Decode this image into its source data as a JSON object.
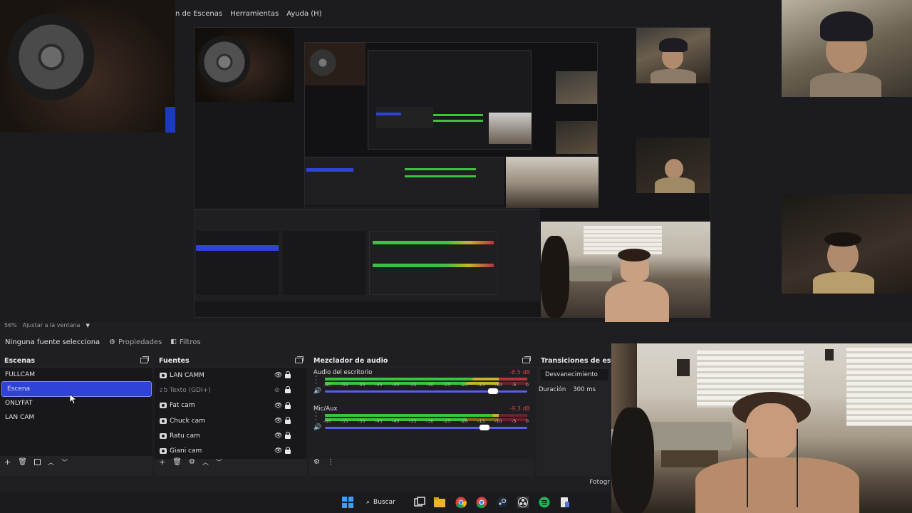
{
  "menu": {
    "items": [
      "n de Escenas",
      "Herramientas",
      "Ayuda (H)"
    ]
  },
  "preview": {
    "zoom": "56%",
    "fit_mode": "Ajustar a la ventana"
  },
  "toolbar": {
    "no_selection": "Ninguna fuente selecciona",
    "properties": "Propiedades",
    "filters": "Filtros"
  },
  "scenes": {
    "title": "Escenas",
    "items": [
      "FULLCAM",
      "Escena",
      "ONLYFAT",
      "LAN CAM"
    ],
    "selected": "Escena"
  },
  "sources": {
    "title": "Fuentes",
    "items": [
      {
        "label": "LAN CAMM",
        "visible": true
      },
      {
        "label": "Texto (GDI+)",
        "visible": false
      },
      {
        "label": "Fat cam",
        "visible": true
      },
      {
        "label": "Chuck cam",
        "visible": true
      },
      {
        "label": "Ratu cam",
        "visible": true
      },
      {
        "label": "Giani cam",
        "visible": true
      }
    ]
  },
  "mixer": {
    "title": "Mezclador de audio",
    "tracks": [
      {
        "name": "Audio del escritorio",
        "db": "-8.5 dB",
        "volume": 0.83
      },
      {
        "name": "Mic/Aux",
        "db": "-9.3 dB",
        "volume": 0.79
      }
    ],
    "scale": [
      "-60",
      "-55",
      "-50",
      "-45",
      "-40",
      "-35",
      "-30",
      "-25",
      "-20",
      "-15",
      "-10",
      "-5",
      "0"
    ]
  },
  "transitions": {
    "title": "Transiciones de escena",
    "selected": "Desvanecimiento",
    "duration_label": "Duración",
    "duration_value": "300 ms"
  },
  "statusbar": {
    "right_text": "Fotogr"
  },
  "taskbar": {
    "search_label": "Buscar"
  },
  "colors": {
    "accent": "#2f43d8",
    "meter_green": "#3cc23c",
    "meter_yellow": "#c8b12c",
    "meter_red": "#b8323b",
    "slider": "#5660e8"
  }
}
